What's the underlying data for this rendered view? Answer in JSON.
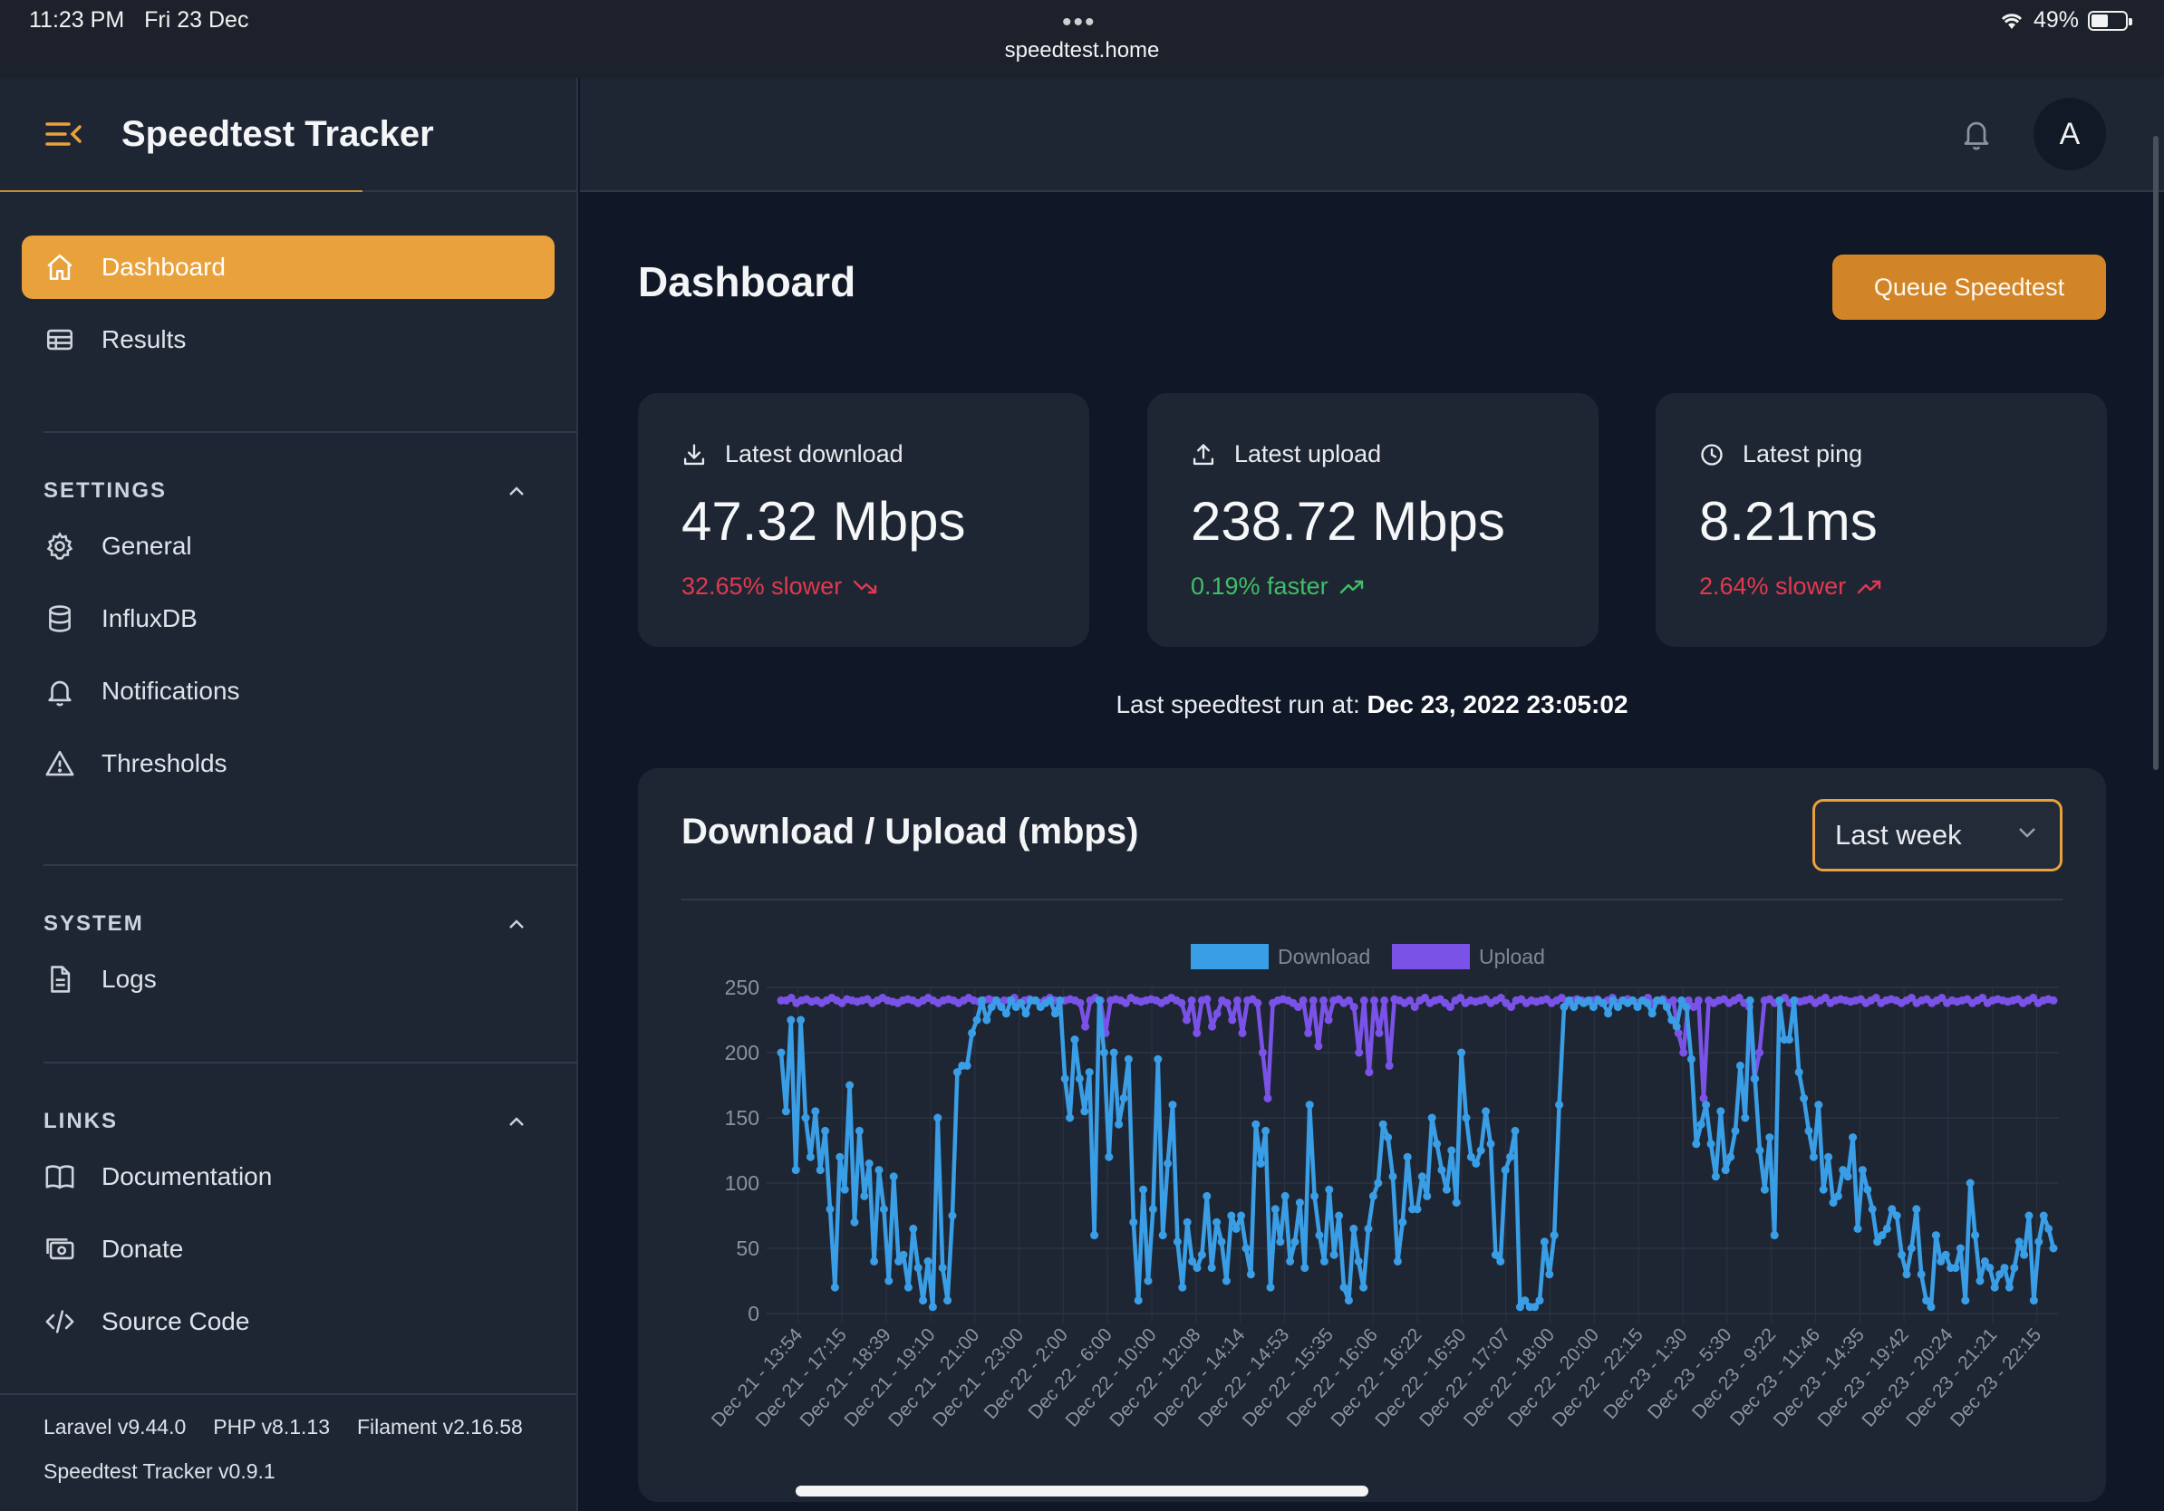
{
  "status_bar": {
    "time": "11:23 PM",
    "date": "Fri 23 Dec",
    "url": "speedtest.home",
    "battery": "49%",
    "battery_level": 0.49
  },
  "app": {
    "title": "Speedtest Tracker",
    "avatar_initial": "A"
  },
  "nav": {
    "main": [
      {
        "label": "Dashboard",
        "icon": "home-icon",
        "active": true
      },
      {
        "label": "Results",
        "icon": "table-icon",
        "active": false
      }
    ],
    "groups": [
      {
        "label": "SETTINGS",
        "items": [
          {
            "label": "General",
            "icon": "gear-icon"
          },
          {
            "label": "InfluxDB",
            "icon": "database-icon"
          },
          {
            "label": "Notifications",
            "icon": "bell-icon"
          },
          {
            "label": "Thresholds",
            "icon": "warning-icon"
          }
        ]
      },
      {
        "label": "SYSTEM",
        "items": [
          {
            "label": "Logs",
            "icon": "document-icon"
          }
        ]
      },
      {
        "label": "LINKS",
        "items": [
          {
            "label": "Documentation",
            "icon": "book-icon"
          },
          {
            "label": "Donate",
            "icon": "cash-icon"
          },
          {
            "label": "Source Code",
            "icon": "code-icon"
          }
        ]
      }
    ]
  },
  "footer": {
    "laravel": "Laravel v9.44.0",
    "php": "PHP v8.1.13",
    "filament": "Filament v2.16.58",
    "version": "Speedtest Tracker v0.9.1"
  },
  "main": {
    "title": "Dashboard",
    "queue_button": "Queue Speedtest",
    "cards": [
      {
        "label": "Latest download",
        "value": "47.32 Mbps",
        "delta": "32.65% slower",
        "trend": "down",
        "color": "#e0394f"
      },
      {
        "label": "Latest upload",
        "value": "238.72 Mbps",
        "delta": "0.19% faster",
        "trend": "up",
        "color": "#3fbf66"
      },
      {
        "label": "Latest ping",
        "value": "8.21ms",
        "delta": "2.64% slower",
        "trend": "up",
        "color": "#e0394f"
      }
    ],
    "last_run_label": "Last speedtest run at:",
    "last_run_value": "Dec 23, 2022 23:05:02"
  },
  "chart_panel": {
    "title": "Download / Upload (mbps)",
    "range_selected": "Last week"
  },
  "chart_data": {
    "type": "line",
    "ylim": [
      0,
      250
    ],
    "yticks": [
      0,
      50,
      100,
      150,
      200,
      250
    ],
    "grid": true,
    "legend_position": "top-center",
    "x_tick_labels": [
      "Dec 21 - 13:54",
      "Dec 21 - 17:15",
      "Dec 21 - 18:39",
      "Dec 21 - 19:10",
      "Dec 21 - 21:00",
      "Dec 21 - 23:00",
      "Dec 22 - 2:00",
      "Dec 22 - 6:00",
      "Dec 22 - 10:00",
      "Dec 22 - 12:08",
      "Dec 22 - 14:14",
      "Dec 22 - 14:53",
      "Dec 22 - 15:35",
      "Dec 22 - 16:06",
      "Dec 22 - 16:22",
      "Dec 22 - 16:50",
      "Dec 22 - 17:07",
      "Dec 22 - 18:00",
      "Dec 22 - 20:00",
      "Dec 22 - 22:15",
      "Dec 23 - 1:30",
      "Dec 23 - 5:30",
      "Dec 23 - 9:22",
      "Dec 23 - 11:46",
      "Dec 23 - 14:35",
      "Dec 23 - 19:42",
      "Dec 23 - 20:24",
      "Dec 23 - 21:21",
      "Dec 23 - 22:15"
    ],
    "series": [
      {
        "name": "Download",
        "color": "#3a9ee6",
        "values": [
          200,
          155,
          225,
          110,
          225,
          150,
          120,
          155,
          110,
          140,
          80,
          20,
          120,
          95,
          175,
          70,
          140,
          90,
          115,
          40,
          110,
          80,
          25,
          105,
          40,
          45,
          20,
          65,
          35,
          10,
          40,
          5,
          150,
          35,
          10,
          75,
          185,
          190,
          190,
          215,
          225,
          240,
          225,
          235,
          240,
          235,
          230,
          240,
          235,
          238,
          230,
          240,
          240,
          235,
          238,
          240,
          230,
          240,
          180,
          150,
          210,
          180,
          155,
          185,
          60,
          240,
          200,
          120,
          200,
          145,
          165,
          195,
          70,
          10,
          95,
          25,
          80,
          195,
          60,
          115,
          160,
          55,
          20,
          70,
          40,
          35,
          45,
          90,
          35,
          70,
          55,
          25,
          75,
          65,
          75,
          50,
          30,
          145,
          115,
          140,
          20,
          80,
          55,
          90,
          40,
          55,
          85,
          35,
          160,
          90,
          60,
          40,
          95,
          45,
          75,
          20,
          10,
          65,
          40,
          20,
          65,
          90,
          100,
          145,
          135,
          105,
          40,
          70,
          120,
          80,
          80,
          105,
          90,
          150,
          130,
          110,
          95,
          125,
          85,
          200,
          150,
          120,
          115,
          125,
          155,
          130,
          45,
          40,
          110,
          120,
          140,
          5,
          10,
          5,
          5,
          10,
          55,
          30,
          60,
          160,
          235,
          240,
          235,
          240,
          238,
          240,
          235,
          240,
          238,
          230,
          240,
          235,
          240,
          238,
          240,
          235,
          240,
          238,
          230,
          240,
          240,
          235,
          225,
          220,
          240,
          235,
          195,
          130,
          145,
          160,
          130,
          105,
          155,
          110,
          120,
          140,
          190,
          150,
          240,
          180,
          125,
          95,
          135,
          60,
          240,
          210,
          210,
          240,
          185,
          165,
          140,
          120,
          160,
          95,
          120,
          85,
          90,
          110,
          105,
          135,
          65,
          110,
          95,
          80,
          55,
          60,
          65,
          80,
          75,
          45,
          30,
          50,
          80,
          30,
          10,
          5,
          60,
          40,
          45,
          35,
          35,
          50,
          10,
          100,
          60,
          25,
          40,
          35,
          20,
          30,
          35,
          20,
          35,
          55,
          45,
          75,
          10,
          55,
          75,
          65,
          50
        ]
      },
      {
        "name": "Upload",
        "color": "#7b52e8",
        "values": [
          240,
          240,
          242,
          238,
          240,
          241,
          239,
          240,
          238,
          240,
          242,
          240,
          238,
          241,
          240,
          239,
          240,
          241,
          238,
          240,
          242,
          240,
          239,
          238,
          240,
          241,
          240,
          238,
          240,
          242,
          240,
          238,
          240,
          241,
          240,
          238,
          240,
          242,
          240,
          239,
          240,
          241,
          240,
          238,
          240,
          240,
          242,
          238,
          240,
          241,
          240,
          238,
          240,
          242,
          240,
          239,
          240,
          241,
          240,
          238,
          220,
          240,
          242,
          240,
          215,
          240,
          241,
          240,
          238,
          242,
          240,
          239,
          240,
          241,
          240,
          238,
          240,
          242,
          240,
          238,
          225,
          240,
          215,
          240,
          241,
          220,
          230,
          240,
          238,
          225,
          240,
          215,
          240,
          241,
          238,
          200,
          165,
          238,
          240,
          241,
          240,
          238,
          235,
          240,
          215,
          240,
          205,
          240,
          225,
          240,
          241,
          238,
          240,
          235,
          200,
          240,
          185,
          240,
          215,
          240,
          190,
          241,
          240,
          238,
          240,
          235,
          240,
          242,
          238,
          240,
          241,
          238,
          235,
          240,
          242,
          238,
          240,
          239,
          240,
          241,
          238,
          240,
          242,
          238,
          235,
          240,
          241,
          238,
          240,
          239,
          240,
          241,
          238,
          240,
          242,
          238,
          240,
          241,
          240,
          239,
          240,
          241,
          238,
          240,
          242,
          238,
          240,
          241,
          240,
          238,
          240,
          242,
          238,
          240,
          241,
          238,
          240,
          215,
          200,
          240,
          235,
          240,
          165,
          240,
          238,
          240,
          241,
          238,
          240,
          242,
          238,
          235,
          180,
          200,
          240,
          241,
          238,
          240,
          242,
          238,
          240,
          239,
          240,
          241,
          238,
          240,
          242,
          238,
          240,
          241,
          240,
          239,
          240,
          241,
          238,
          240,
          242,
          238,
          240,
          241,
          240,
          238,
          240,
          242,
          238,
          240,
          241,
          238,
          240,
          242,
          238,
          240,
          239,
          240,
          241,
          238,
          240,
          242,
          238,
          240,
          241,
          240,
          239,
          240,
          241,
          238,
          240,
          242,
          238,
          240,
          241,
          240
        ]
      }
    ]
  }
}
